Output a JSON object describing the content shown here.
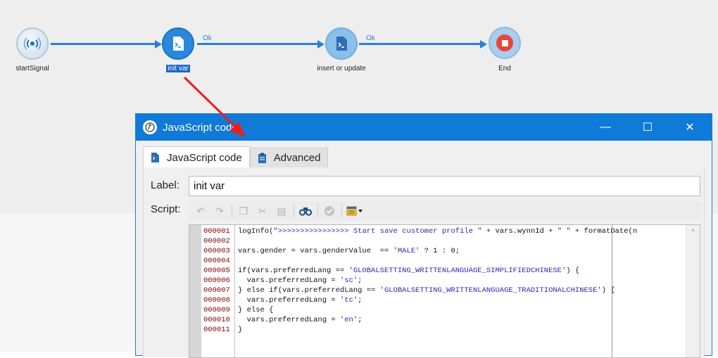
{
  "workflow": {
    "nodes": [
      {
        "label": "startSignal",
        "icon": "signal-icon"
      },
      {
        "label": "init var",
        "icon": "script-icon",
        "selected": true
      },
      {
        "label": "insert or update",
        "icon": "script-icon"
      },
      {
        "label": "End",
        "icon": "stop-icon"
      }
    ],
    "edges": [
      {
        "label": ""
      },
      {
        "label": "Ok"
      },
      {
        "label": "Ok"
      }
    ]
  },
  "dialog": {
    "title": "JavaScript code",
    "minimize": "—",
    "maximize": "☐",
    "close": "✕",
    "tabs": [
      {
        "label": "JavaScript code",
        "active": true,
        "icon": "script-file-icon"
      },
      {
        "label": "Advanced",
        "active": false,
        "icon": "clipboard-icon"
      }
    ],
    "label_caption": "Label:",
    "label_value": "init var",
    "script_caption": "Script:",
    "toolbar": [
      "undo-icon",
      "redo-icon",
      "copy-icon",
      "cut-icon",
      "paste-icon",
      "find-icon",
      "check-icon",
      "insert-dropdown-icon"
    ],
    "code": {
      "line_numbers": [
        "000001",
        "000002",
        "000003",
        "000004",
        "000005",
        "000006",
        "000007",
        "000008",
        "000009",
        "000010",
        "000011"
      ],
      "lines": [
        "logInfo(\">>>>>>>>>>>>>>>> Start save customer profile \" + vars.wynnId + \" \" + formatDate(n",
        "",
        "vars.gender = vars.genderValue  == 'MALE' ? 1 : 0;",
        "",
        "if(vars.preferredLang == 'GLOBALSETTING_WRITTENLANGUAGE_SIMPLIFIEDCHINESE') {",
        "  vars.preferredLang = 'sc';",
        "} else if(vars.preferredLang == 'GLOBALSETTING_WRITTENLANGUAGE_TRADITIONALCHINESE') {",
        "  vars.preferredLang = 'tc';",
        "} else {",
        "  vars.preferredLang = 'en';",
        "}"
      ]
    }
  },
  "colors": {
    "accent": "#2a7fd4",
    "titlebar": "#0f7ad8",
    "selection": "#2164c4",
    "stop": "#e8453c",
    "callout_arrow": "#ee1c1c"
  }
}
